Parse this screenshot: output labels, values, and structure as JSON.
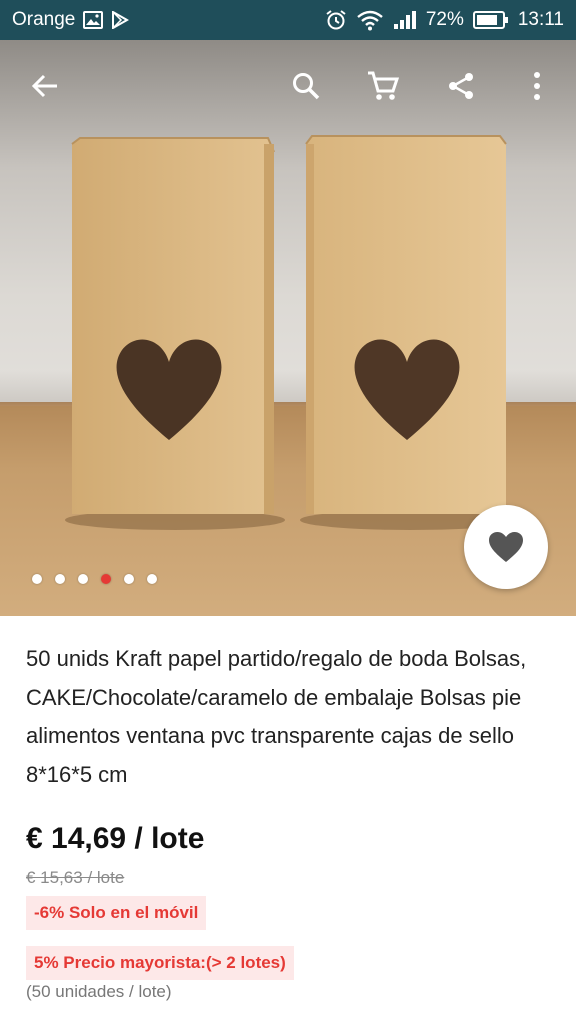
{
  "status_bar": {
    "carrier": "Orange",
    "battery": "72%",
    "time": "13:11",
    "icons": [
      "image-icon",
      "play-store-icon",
      "alarm-icon",
      "wifi-icon",
      "signal-icon",
      "battery-icon"
    ]
  },
  "app_bar": {
    "icons": [
      "back-arrow-icon",
      "search-icon",
      "cart-icon",
      "share-icon",
      "more-vert-icon"
    ]
  },
  "gallery": {
    "dot_count": 6,
    "active_index": 3
  },
  "product": {
    "title": "50 unids Kraft papel partido/regalo de boda Bolsas, CAKE/Chocolate/caramelo de embalaje Bolsas pie alimentos ventana pvc transparente cajas de sello 8*16*5 cm",
    "price": "€ 14,69 / lote",
    "old_price": "€ 15,63 / lote",
    "mobile_discount": "-6%  Solo en el móvil",
    "wholesale": "5%  Precio mayorista:(> 2 lotes)",
    "units": "(50 unidades / lote)"
  },
  "colors": {
    "status_bar": "#1f4e5a",
    "accent_red": "#e53935",
    "badge_bg": "#fde8e8"
  }
}
